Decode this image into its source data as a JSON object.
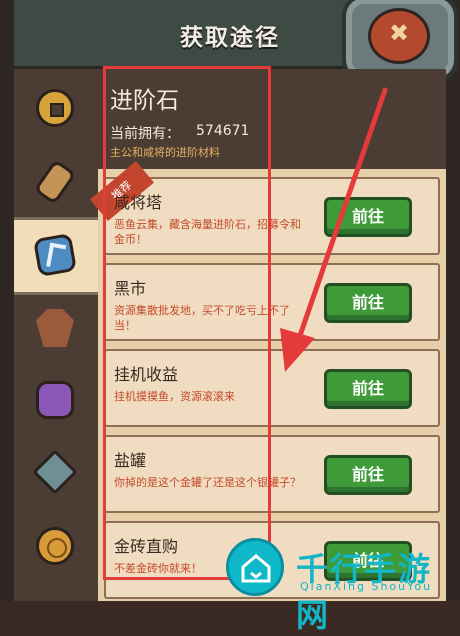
{
  "header": {
    "title": "获取途径"
  },
  "info": {
    "item_name": "进阶石",
    "owned_label": "当前拥有：",
    "owned_value": "574671",
    "description": "主公和咸将的进阶材料"
  },
  "sources": [
    {
      "name": "咸将塔",
      "desc": "恶鱼云集，藏含海量进阶石，招募令和金币！",
      "button": "前往",
      "tag": "推荐"
    },
    {
      "name": "黑市",
      "desc": "资源集散批发地，买不了吃亏上不了当！",
      "button": "前往"
    },
    {
      "name": "挂机收益",
      "desc": "挂机摸摸鱼，资源滚滚来",
      "button": "前往"
    },
    {
      "name": "盐罐",
      "desc": "你掉的是这个金罐了还是这个银罐子？",
      "button": "前往"
    },
    {
      "name": "金砖直购",
      "desc": "不差金砖你就来！",
      "button": "前往"
    }
  ],
  "sidebar": {
    "items": [
      {
        "icon": "coin-icon"
      },
      {
        "icon": "scroll-icon"
      },
      {
        "icon": "rune-icon",
        "active": true
      },
      {
        "icon": "coffin-icon"
      },
      {
        "icon": "gem-icon"
      },
      {
        "icon": "stone-icon"
      },
      {
        "icon": "medal-icon"
      }
    ]
  },
  "watermark": {
    "cn": "千行手游网",
    "en": "QianXing ShouYou"
  },
  "colors": {
    "accent_green": "#3f9b3a",
    "annotation_red": "#e43a3a",
    "watermark": "#12b6c5"
  }
}
